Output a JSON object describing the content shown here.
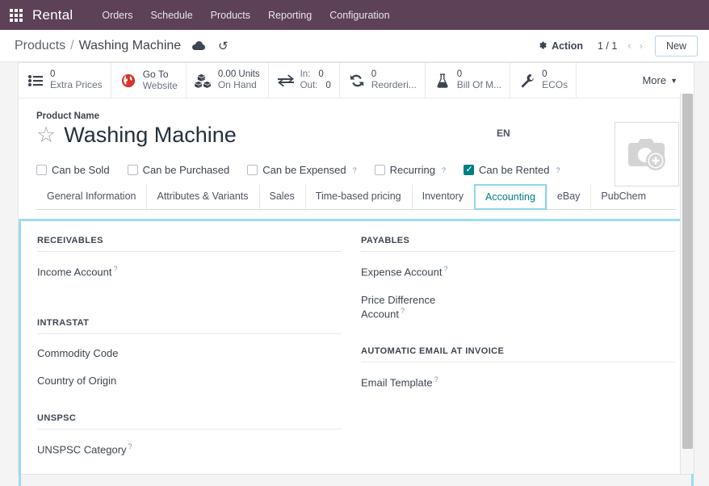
{
  "navbar": {
    "apps_icon": "apps-grid-icon",
    "brand": "Rental",
    "items": [
      {
        "label": "Orders"
      },
      {
        "label": "Schedule"
      },
      {
        "label": "Products"
      },
      {
        "label": "Reporting"
      },
      {
        "label": "Configuration"
      }
    ]
  },
  "controlbar": {
    "breadcrumb_parent": "Products",
    "breadcrumb_sep": "/",
    "breadcrumb_current": "Washing Machine",
    "save_icon": "cloud-save-icon",
    "discard_icon": "undo-discard-icon",
    "action_label": "Action",
    "action_icon": "gear-icon",
    "pager": "1 / 1",
    "prev_icon": "chevron-left-icon",
    "next_icon": "chevron-right-icon",
    "new_label": "New"
  },
  "smart_buttons": [
    {
      "icon": "list-icon",
      "value": "0",
      "label": "Extra Prices"
    },
    {
      "icon": "globe-icon",
      "value": "",
      "label_line1": "Go To",
      "label_line2": "Website"
    },
    {
      "icon": "boxes-icon",
      "value": "0.00 Units",
      "label": "On Hand"
    },
    {
      "icon": "exchange-icon",
      "in_key": "In:",
      "in_value": "0",
      "out_key": "Out:",
      "out_value": "0"
    },
    {
      "icon": "refresh-icon",
      "value": "0",
      "label": "Reorderi..."
    },
    {
      "icon": "flask-icon",
      "value": "0",
      "label": "Bill Of M..."
    },
    {
      "icon": "wrench-icon",
      "value": "0",
      "label": "ECOs"
    }
  ],
  "more_button": {
    "label": "More",
    "icon": "caret-down-icon"
  },
  "product": {
    "name_field_label": "Product Name",
    "favorite_icon": "star-outline-icon",
    "name": "Washing Machine",
    "language_badge": "EN",
    "image_placeholder_icon": "camera-add-icon"
  },
  "checkboxes": [
    {
      "label": "Can be Sold",
      "checked": false,
      "has_help": false
    },
    {
      "label": "Can be Purchased",
      "checked": false,
      "has_help": false
    },
    {
      "label": "Can be Expensed",
      "checked": false,
      "has_help": true
    },
    {
      "label": "Recurring",
      "checked": false,
      "has_help": true
    },
    {
      "label": "Can be Rented",
      "checked": true,
      "has_help": true
    }
  ],
  "tabs": [
    {
      "label": "General Information",
      "active": false,
      "highlighted": false
    },
    {
      "label": "Attributes & Variants",
      "active": false,
      "highlighted": false
    },
    {
      "label": "Sales",
      "active": false,
      "highlighted": false
    },
    {
      "label": "Time-based pricing",
      "active": false,
      "highlighted": false
    },
    {
      "label": "Inventory",
      "active": false,
      "highlighted": false
    },
    {
      "label": "Accounting",
      "active": true,
      "highlighted": true
    },
    {
      "label": "eBay",
      "active": false,
      "highlighted": false
    },
    {
      "label": "PubChem",
      "active": false,
      "highlighted": false
    }
  ],
  "accounting_tab": {
    "left": [
      {
        "section": "RECEIVABLES",
        "fields": [
          {
            "label": "Income Account",
            "has_help": true
          }
        ]
      },
      {
        "section": "INTRASTAT",
        "fields": [
          {
            "label": "Commodity Code",
            "has_help": false
          },
          {
            "label": "Country of Origin",
            "has_help": false
          }
        ]
      },
      {
        "section": "UNSPSC",
        "fields": [
          {
            "label": "UNSPSC Category",
            "has_help": true
          }
        ]
      }
    ],
    "right": [
      {
        "section": "PAYABLES",
        "fields": [
          {
            "label": "Expense Account",
            "has_help": true
          },
          {
            "label": "Price Difference Account",
            "has_help": true
          }
        ]
      },
      {
        "section": "AUTOMATIC EMAIL AT INVOICE",
        "fields": [
          {
            "label": "Email Template",
            "has_help": true
          }
        ]
      }
    ]
  },
  "colors": {
    "navbar": "#5d4157",
    "accent_teal": "#017e84",
    "highlight_cyan": "#9bdcee",
    "globe_red": "#d9352c"
  },
  "scrollbar": {
    "name": "vertical-scrollbar"
  }
}
